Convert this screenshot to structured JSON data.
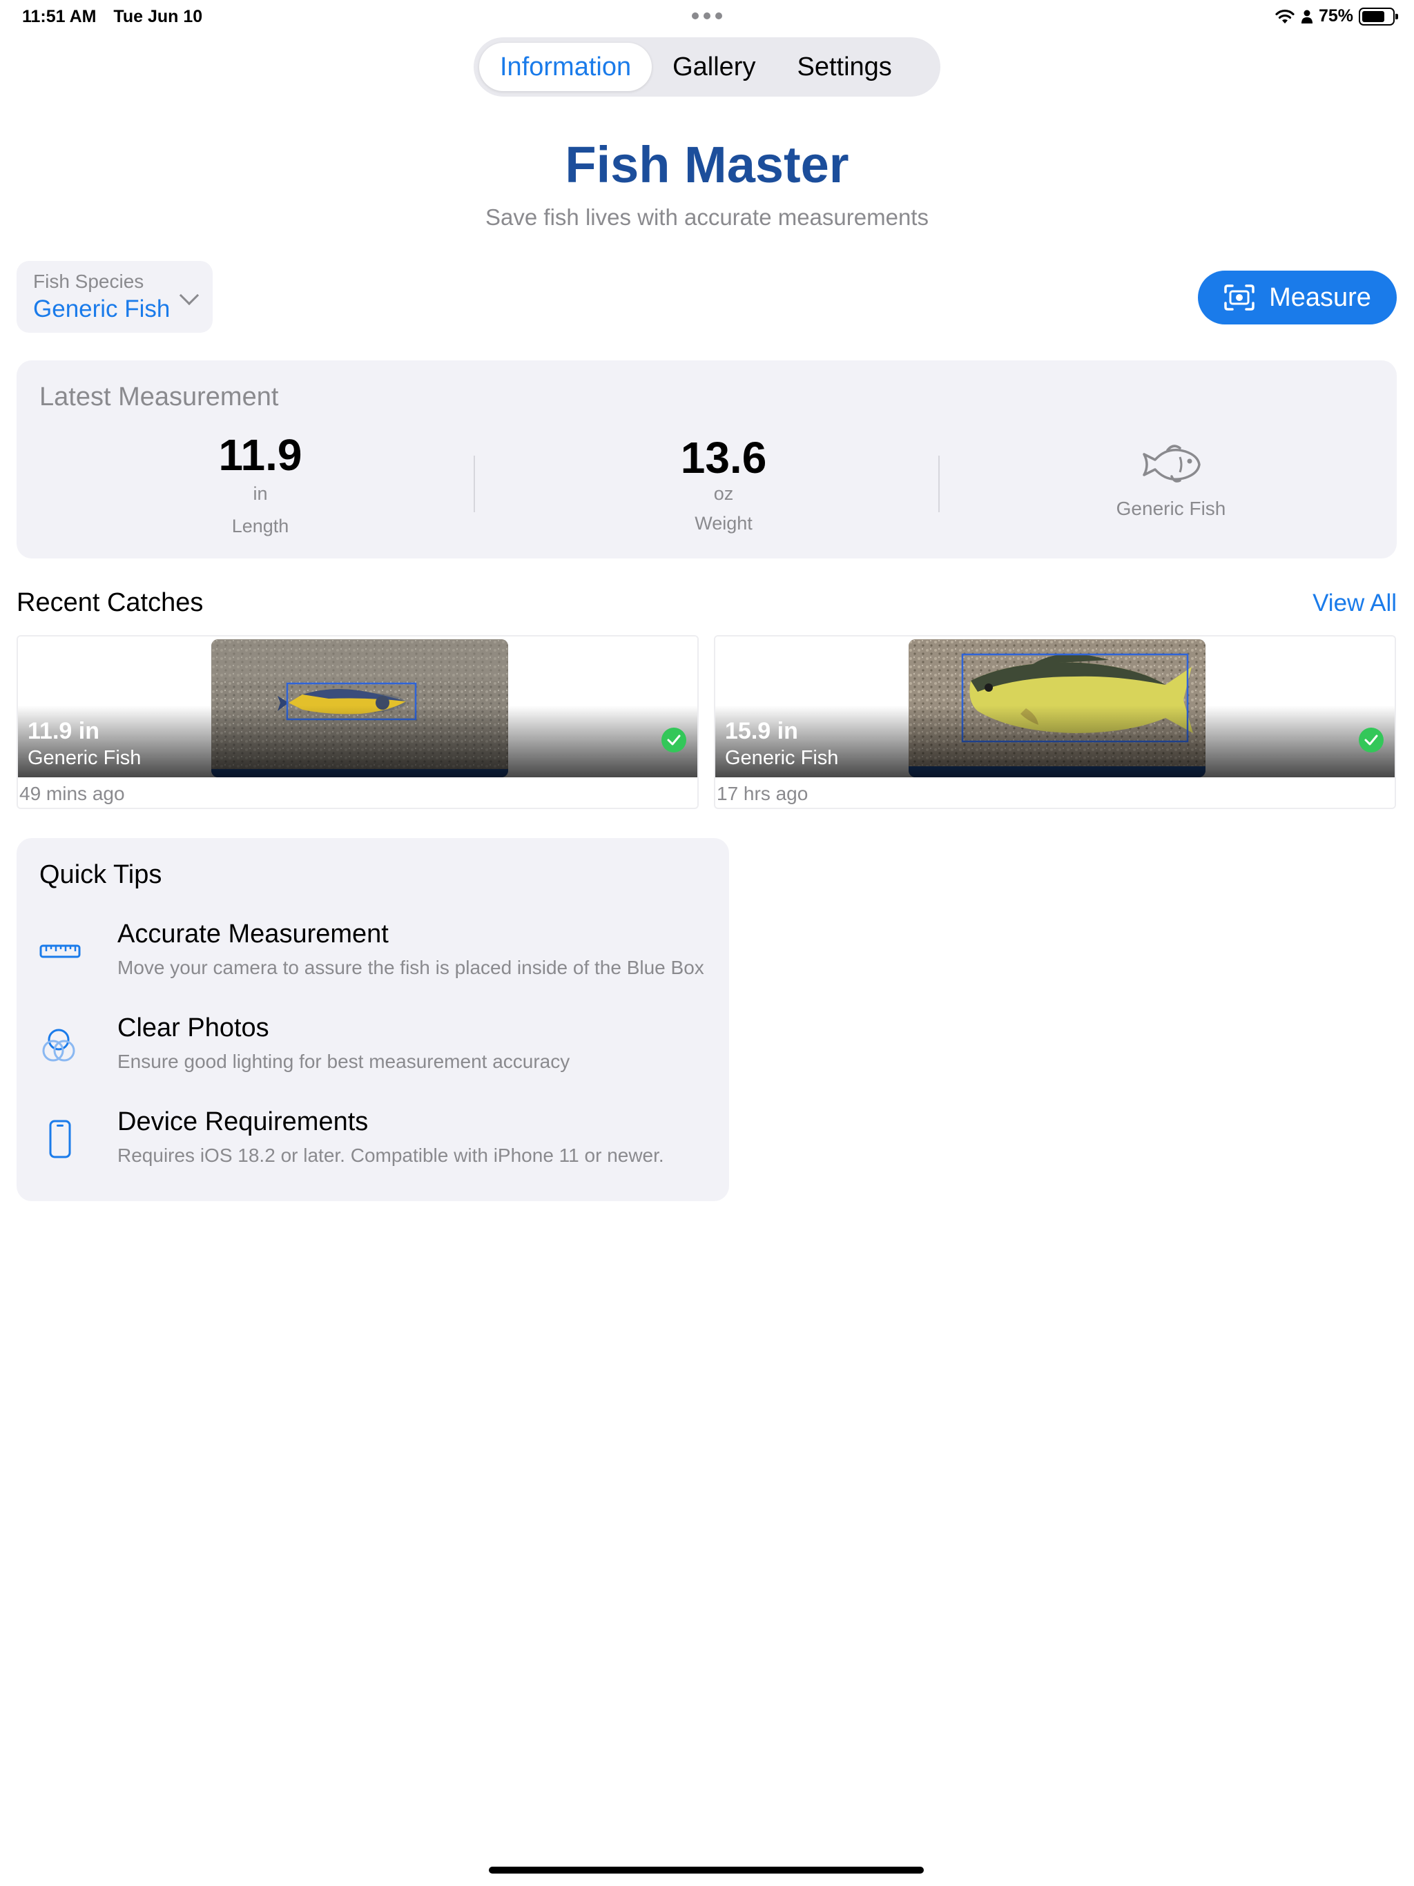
{
  "status_bar": {
    "time": "11:51 AM",
    "date": "Tue Jun 10",
    "battery": "75%",
    "battery_level": 0.75
  },
  "tabs": [
    {
      "label": "Information",
      "active": true
    },
    {
      "label": "Gallery",
      "active": false
    },
    {
      "label": "Settings",
      "active": false
    }
  ],
  "app": {
    "title": "Fish Master",
    "subtitle": "Save fish lives with accurate measurements"
  },
  "species_picker": {
    "label": "Fish Species",
    "value": "Generic Fish"
  },
  "measure_button": {
    "label": "Measure"
  },
  "latest_measurement": {
    "header": "Latest Measurement",
    "length": {
      "value": "11.9",
      "unit": "in",
      "label": "Length"
    },
    "weight": {
      "value": "13.6",
      "unit": "oz",
      "label": "Weight"
    },
    "species": "Generic Fish"
  },
  "recent_catches": {
    "header": "Recent Catches",
    "view_all": "View All",
    "items": [
      {
        "length": "11.9 in",
        "species": "Generic Fish",
        "ago": "49 mins ago"
      },
      {
        "length": "15.9 in",
        "species": "Generic Fish",
        "ago": "17 hrs ago"
      }
    ]
  },
  "quick_tips": {
    "header": "Quick Tips",
    "items": [
      {
        "icon": "ruler-icon",
        "title": "Accurate Measurement",
        "desc": "Move your camera to assure the fish is placed inside of the Blue Box"
      },
      {
        "icon": "circles-icon",
        "title": "Clear Photos",
        "desc": "Ensure good lighting for best measurement accuracy"
      },
      {
        "icon": "iphone-icon",
        "title": "Device Requirements",
        "desc": "Requires iOS 18.2 or later. Compatible with iPhone 11 or newer."
      }
    ]
  },
  "colors": {
    "accent": "#1a7bea",
    "title": "#1c4e9b",
    "card": "#f2f2f7",
    "secondary_text": "#8a8a8e",
    "success": "#33c759"
  }
}
